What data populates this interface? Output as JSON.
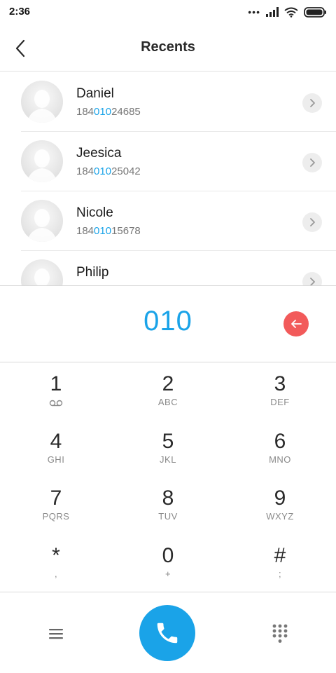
{
  "status_bar": {
    "time": "2:36",
    "icons": [
      "more-dots-icon",
      "signal-icon",
      "wifi-icon",
      "battery-icon"
    ]
  },
  "header": {
    "title": "Recents",
    "back_icon": "chevron-left-icon"
  },
  "contacts": [
    {
      "name": "Daniel",
      "number_prefix": "184",
      "number_match": "010",
      "number_suffix": "24685"
    },
    {
      "name": "Jeesica",
      "number_prefix": "184",
      "number_match": "010",
      "number_suffix": "25042"
    },
    {
      "name": "Nicole",
      "number_prefix": "184",
      "number_match": "010",
      "number_suffix": "15678"
    },
    {
      "name": "Philip",
      "number_prefix": "",
      "number_match": "",
      "number_suffix": ""
    }
  ],
  "dialer": {
    "input_value": "010"
  },
  "keypad": [
    {
      "digit": "1",
      "letters": "",
      "icon": "voicemail-icon"
    },
    {
      "digit": "2",
      "letters": "ABC"
    },
    {
      "digit": "3",
      "letters": "DEF"
    },
    {
      "digit": "4",
      "letters": "GHI"
    },
    {
      "digit": "5",
      "letters": "JKL"
    },
    {
      "digit": "6",
      "letters": "MNO"
    },
    {
      "digit": "7",
      "letters": "PQRS"
    },
    {
      "digit": "8",
      "letters": "TUV"
    },
    {
      "digit": "9",
      "letters": "WXYZ"
    },
    {
      "digit": "*",
      "letters": ","
    },
    {
      "digit": "0",
      "letters": "+"
    },
    {
      "digit": "#",
      "letters": ";"
    }
  ],
  "bottom_bar": {
    "icons": [
      "menu-icon",
      "phone-icon",
      "keypad-grid-icon"
    ]
  },
  "colors": {
    "accent": "#1aa3e8",
    "backspace": "#f25a5a"
  }
}
